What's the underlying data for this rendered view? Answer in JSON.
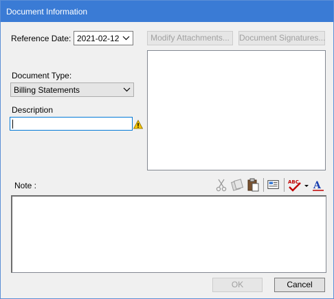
{
  "window": {
    "title": "Document Information"
  },
  "form": {
    "reference_date_label": "Reference Date:",
    "reference_date_value": "2021-02-12",
    "document_type_label": "Document Type:",
    "document_type_value": "Billing Statements",
    "description_label": "Description",
    "description_value": "",
    "note_label": "Note :"
  },
  "buttons": {
    "modify_attachments": "Modify Attachments...",
    "document_signatures": "Document Signatures...",
    "ok": "OK",
    "cancel": "Cancel"
  },
  "toolbar": {
    "icons": [
      "cut-icon",
      "copy-icon",
      "paste-icon",
      "insert-icon",
      "spellcheck-icon",
      "dropdown-arrow-icon",
      "font-icon"
    ],
    "spellcheck_glyph": "ABC",
    "font_glyph": "A"
  },
  "colors": {
    "titlebar": "#3a7bd5",
    "focus_border": "#0078d7",
    "warning": "#f5c400",
    "spellcheck": "#c00000"
  }
}
